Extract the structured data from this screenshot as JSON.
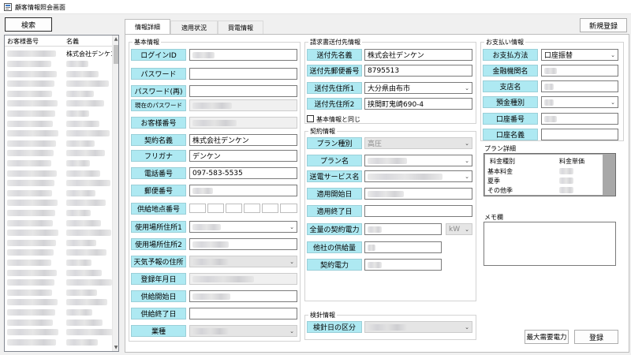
{
  "window": {
    "title": "顧客情報照会画面"
  },
  "left": {
    "search_label": "検索",
    "col_number": "お客様番号",
    "col_name": "名義",
    "first_row_name": "株式会社デンケン"
  },
  "tabs": [
    {
      "label": "情報詳細"
    },
    {
      "label": "適用状況"
    },
    {
      "label": "買電情報"
    }
  ],
  "new_register_label": "新規登録",
  "basic": {
    "group": "基本情報",
    "login_id": "ログインID",
    "password": "パスワード",
    "password_re": "パスワード(再)",
    "current_password": "現在のパスワード",
    "customer_no": "お客様番号",
    "contract_name": "契約名義",
    "contract_name_value": "株式会社デンケン",
    "furigana": "フリガナ",
    "furigana_value": "デンケン",
    "phone": "電話番号",
    "phone_value": "097-583-5535",
    "zip": "郵便番号",
    "supply_point": "供給地点番号",
    "addr1": "使用場所住所1",
    "addr2": "使用場所住所2",
    "weather": "天気予報の住所",
    "reg_date": "登録年月日",
    "supply_start": "供給開始日",
    "supply_end": "供給終了日",
    "industry": "業種"
  },
  "billing": {
    "group": "請求書送付先情報",
    "to_name": "送付先名義",
    "to_name_value": "株式会社デンケン",
    "to_zip": "送付先郵便番号",
    "to_zip_value": "8795513",
    "to_addr1": "送付先住所1",
    "to_addr1_value": "大分県由布市",
    "to_addr2": "送付先住所2",
    "to_addr2_value": "挟間町鬼崎690-4",
    "same_as_basic": "基本情報と同じ"
  },
  "contract": {
    "group": "契約情報",
    "plan_type": "プラン種別",
    "plan_type_value": "高圧",
    "plan_name": "プラン名",
    "service_name": "送電サービス名",
    "apply_start": "適用開始日",
    "apply_end": "適用終了日",
    "total_power": "全量の契約電力",
    "unit_kw": "kW",
    "other_supply": "他社の供給量",
    "contract_power": "契約電力"
  },
  "meter": {
    "group": "検針情報",
    "category": "検針日の区分"
  },
  "payment": {
    "group": "お支払い情報",
    "method": "お支払方法",
    "method_value": "口座振替",
    "bank": "金融機関名",
    "branch": "支店名",
    "deposit_type": "預金種別",
    "account_no": "口座番号",
    "account_name": "口座名義"
  },
  "plan_detail": {
    "group": "プラン詳細",
    "col_type": "料金種別",
    "col_price": "料金単価",
    "rows": [
      "基本料金",
      "夏季",
      "その他季"
    ]
  },
  "memo": {
    "group": "メモ欄"
  },
  "buttons": {
    "max_demand": "最大需要電力",
    "register": "登録"
  }
}
